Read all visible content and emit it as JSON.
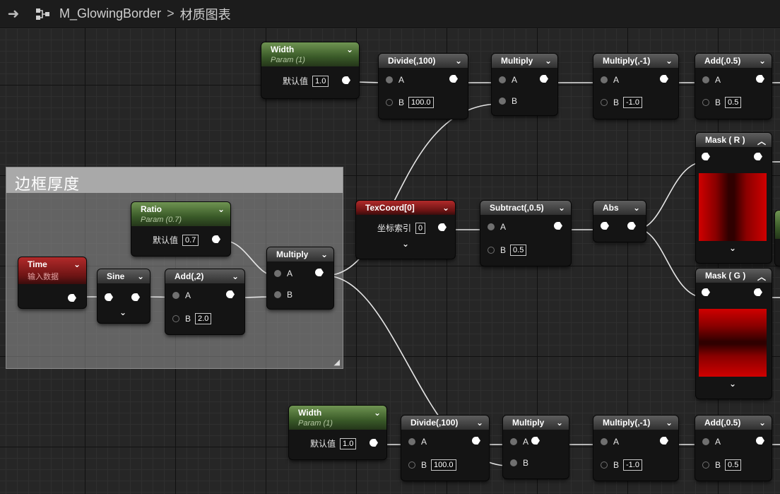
{
  "topbar": {
    "title": "M_GlowingBorder",
    "breadcrumb": "材质图表",
    "separator": ">"
  },
  "comment": {
    "title": "边框厚度"
  },
  "labels": {
    "default_value": "默认值",
    "coord_index": "坐标索引",
    "a": "A",
    "b": "B"
  },
  "nodes": {
    "width_top": {
      "title": "Width",
      "subtitle": "Param (1)",
      "value": "1.0"
    },
    "divide_top": {
      "title": "Divide(,100)",
      "b": "100.0"
    },
    "multiply_top": {
      "title": "Multiply"
    },
    "multiply_neg_top": {
      "title": "Multiply(,-1)",
      "b": "-1.0"
    },
    "add_top": {
      "title": "Add(,0.5)",
      "b": "0.5"
    },
    "mask_r": {
      "title": "Mask ( R )"
    },
    "mask_g": {
      "title": "Mask ( G )"
    },
    "ratio": {
      "title": "Ratio",
      "subtitle": "Param (0.7)",
      "value": "0.7"
    },
    "time": {
      "title": "Time",
      "subtitle": "输入数据"
    },
    "sine": {
      "title": "Sine"
    },
    "add2": {
      "title": "Add(,2)",
      "b": "2.0"
    },
    "multiply_mid": {
      "title": "Multiply"
    },
    "texcoord": {
      "title": "TexCoord[0]",
      "value": "0"
    },
    "subtract": {
      "title": "Subtract(,0.5)",
      "b": "0.5"
    },
    "abs": {
      "title": "Abs"
    },
    "width_bottom": {
      "title": "Width",
      "subtitle": "Param (1)",
      "value": "1.0"
    },
    "divide_bottom": {
      "title": "Divide(,100)",
      "b": "100.0"
    },
    "multiply_bottom": {
      "title": "Multiply"
    },
    "multiply_neg_bottom": {
      "title": "Multiply(,-1)",
      "b": "-1.0"
    },
    "add_bottom": {
      "title": "Add(,0.5)",
      "b": "0.5"
    }
  },
  "icons": [
    "arrow-right-icon",
    "graph-icon",
    "chevron-down-icon",
    "chevron-up-icon",
    "output-pin-icon",
    "input-pin-icon",
    "resize-grip-icon"
  ],
  "colors": {
    "param_header": "#4f7a36",
    "input_header": "#8a1a1a",
    "wire": "#e6e6e6",
    "mask_red": "#c00000"
  }
}
